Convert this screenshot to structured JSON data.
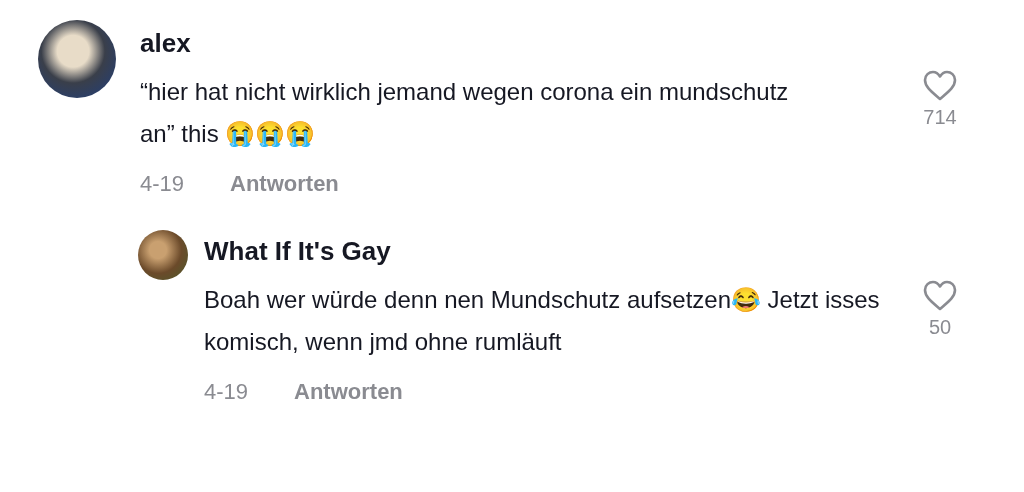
{
  "comments": [
    {
      "author": "alex",
      "text": "“hier hat nicht wirklich jemand wegen corona ein mundschutz an” this 😭😭😭",
      "date": "4-19",
      "reply_label": "Antworten",
      "likes": "714",
      "children": [
        {
          "author": "What If It's Gay",
          "text": "Boah wer würde denn nen Mundschutz aufsetzen😂 Jetzt isses komisch, wenn jmd ohne rumläuft",
          "date": "4-19",
          "reply_label": "Antworten",
          "likes": "50"
        }
      ]
    }
  ]
}
